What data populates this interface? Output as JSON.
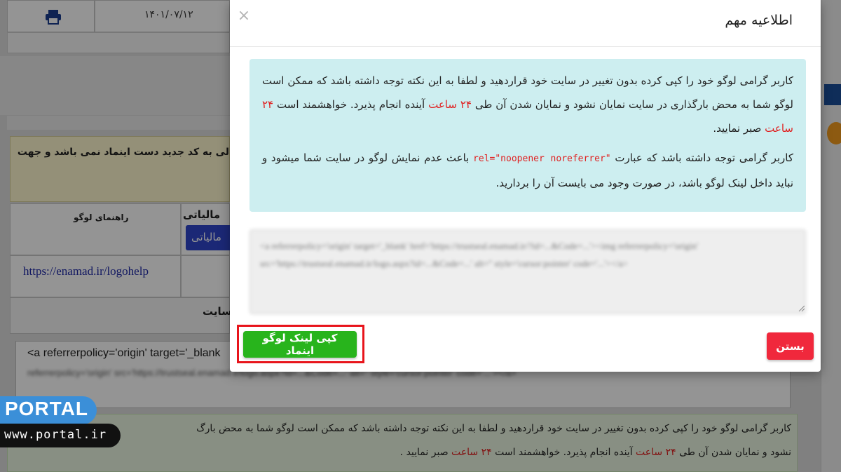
{
  "background": {
    "date": "۱۴۰۱/۰۷/۱۲",
    "print_icon": "printer-icon",
    "yellow_notice": "لی به کد جدید دست اینماد نمی باشد و جهت",
    "logo_guide_header": "راهنمای لوگو",
    "tax_label": "مالیاتی",
    "tax_button": "مالیاتی",
    "logo_help_link": "https://enamad.ir/logohelp",
    "site_label": "سایت",
    "code_snippet_start": "<a referrerpolicy='origin' target='_blank",
    "code_snippet_blurred": "referrerpolicy='origin' src='https://trustseal.enamad.ir/logo.aspx?id=...&Code=...' alt='' style='cursor:pointer' code='...'></a>",
    "bottom_notice_line1": "کاربر گرامی لوگو خود را کپی کرده بدون تغییر در سایت خود قراردهید و لطفا به این نکته توجه داشته باشد که ممکن است لوگو شما به محض بارگ",
    "bottom_notice_line2_a": "نشود و نمایان شدن آن طی",
    "bottom_notice_line2_b": "۲۴ ساعت",
    "bottom_notice_line2_c": "آینده انجام پذیرد. خواهشمند است",
    "bottom_notice_line2_d": "۲۴ ساعت",
    "bottom_notice_line2_e": "صبر نمایید ."
  },
  "modal": {
    "title": "اطلاعیه مهم",
    "close_glyph": "×",
    "notice_p1_a": "کاربر گرامی لوگو خود را کپی کرده بدون تغییر در سایت خود قراردهید و لطفا به این نکته توجه داشته باشد که ممکن است لوگو شما به محض بارگذاری در سایت نمایان نشود و نمایان شدن آن طی",
    "notice_p1_b": "۲۴ ساعت",
    "notice_p1_c": "آینده انجام پذیرد. خواهشمند است",
    "notice_p1_d": "۲۴ ساعت",
    "notice_p1_e": "صبر نمایید.",
    "notice_p2_a": "کاربر گرامی توجه داشته باشد که عبارت",
    "notice_p2_b": "rel=\"noopener noreferrer\"",
    "notice_p2_c": "باعث عدم نمایش لوگو در سایت شما میشود و نباید داخل لینک لوگو باشد، در صورت وجود می بایست آن را بردارید.",
    "code_text": "<a referrerpolicy='origin' target='_blank' href='https://trustseal.enamad.ir/?id=...&Code=...'><img referrerpolicy='origin' src='https://trustseal.enamad.ir/logo.aspx?id=...&Code=...' alt='' style='cursor:pointer' code='...'></a>",
    "copy_button": "کپی لینک لوگو اینماد",
    "close_button": "بستن"
  },
  "watermark": {
    "brand": "PORTAL",
    "url": "www.portal.ir"
  },
  "colors": {
    "accent_green": "#28b41c",
    "danger_red": "#f0283c",
    "info_bg": "#cdeef0",
    "highlight_red": "#e8141b",
    "portal_blue": "#3b8fd8"
  }
}
